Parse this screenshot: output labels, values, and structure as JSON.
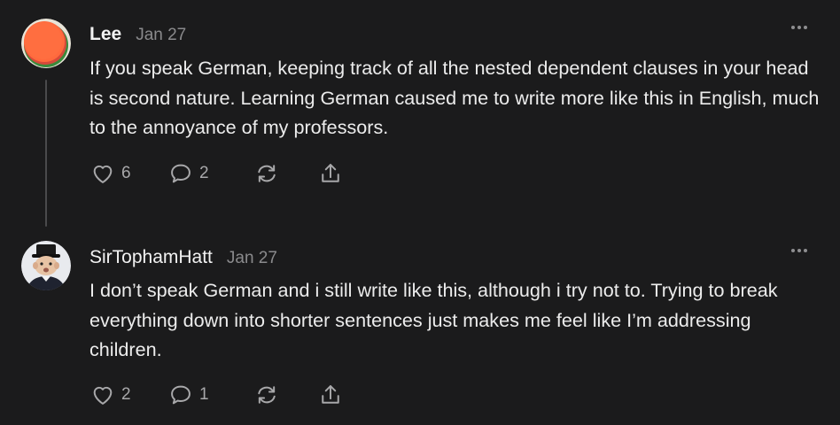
{
  "comments": [
    {
      "author": "Lee",
      "date": "Jan 27",
      "avatar_icon": "orange-circle-avatar",
      "text": "If you speak German, keeping track of all the nested dependent clauses in your head is second nature. Learning German caused me to write more like this in English, much to the annoyance of my professors.",
      "likes": "6",
      "replies": "2"
    },
    {
      "author": "SirTophamHatt",
      "date": "Jan 27",
      "avatar_icon": "top-hat-man-avatar",
      "text": "I don’t speak German and i still write like this, although i try not to. Trying to break everything down into shorter sentences just makes me feel like I’m addressing children.",
      "likes": "2",
      "replies": "1"
    }
  ],
  "icons": {
    "like": "heart-icon",
    "reply": "comment-bubble-icon",
    "restack": "restack-icon",
    "share": "share-icon",
    "more": "more-dots-icon"
  },
  "colors": {
    "background": "#1b1b1c",
    "text": "#ececec",
    "muted": "#8a8a8c",
    "icon": "#a8a8aa"
  }
}
